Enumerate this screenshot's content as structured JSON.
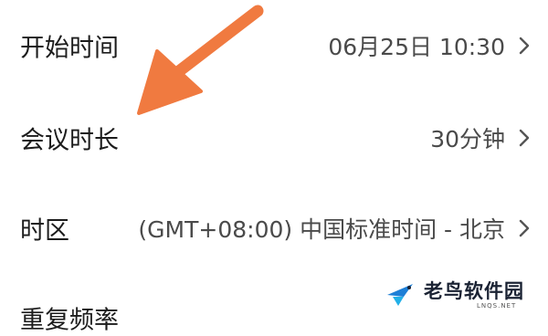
{
  "settings": {
    "rows": [
      {
        "label": "开始时间",
        "value": "06月25日 10:30"
      },
      {
        "label": "会议时长",
        "value": "30分钟"
      },
      {
        "label": "时区",
        "value": "(GMT+08:00) 中国标准时间 - 北京"
      },
      {
        "label": "重复频率",
        "value": ""
      }
    ]
  },
  "watermark": {
    "text": "老鸟软件园",
    "sub": "LNQS.NET"
  },
  "colors": {
    "arrow": "#f07a40",
    "chevron": "#555555",
    "label": "#1c1c1c",
    "value": "#4a4a4a"
  },
  "icons": {
    "chevron": "chevron-right-icon",
    "annotation": "arrow-annotation-icon",
    "logo": "bird-logo-icon"
  }
}
